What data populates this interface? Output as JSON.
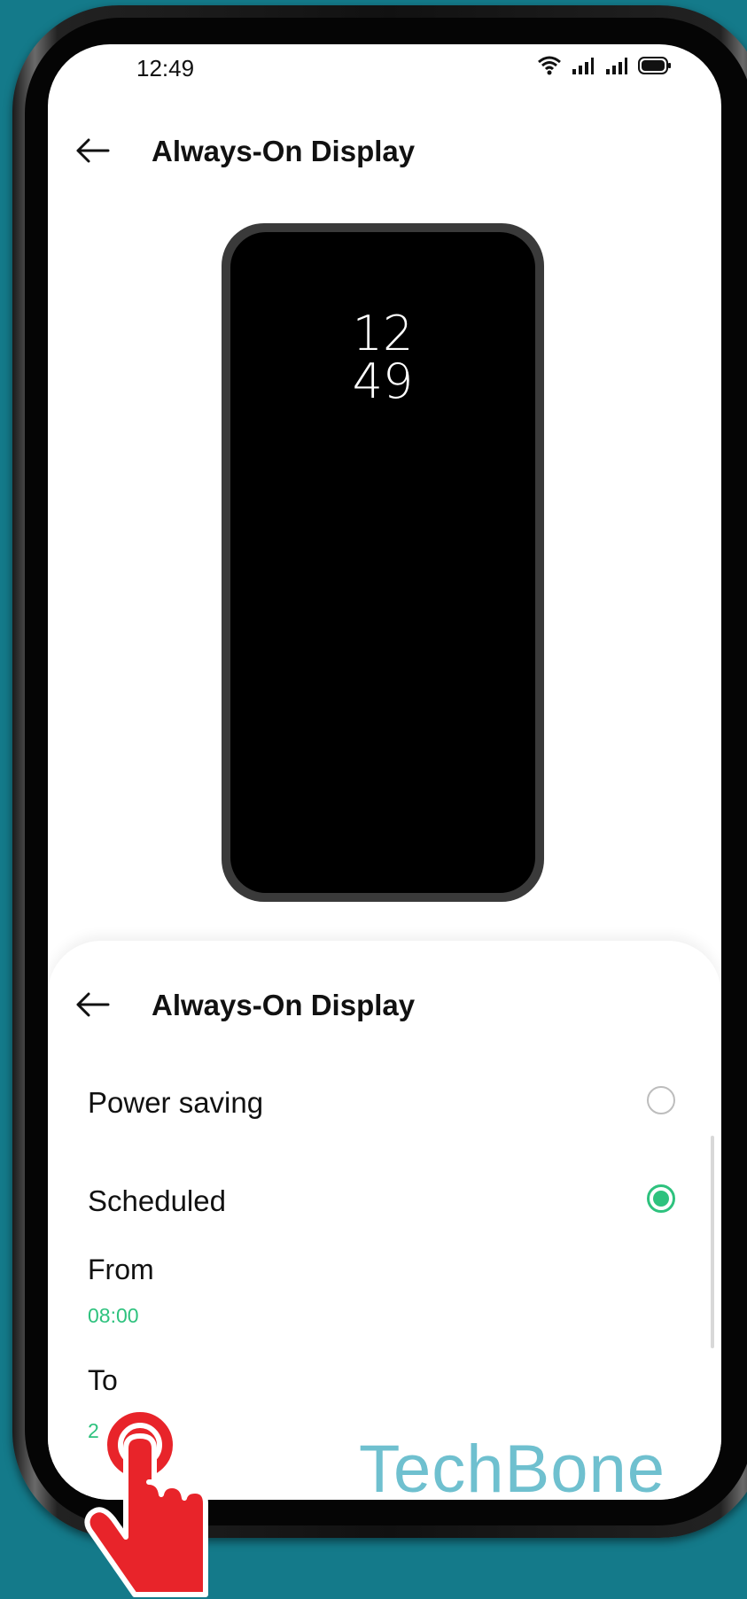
{
  "status_bar": {
    "time": "12:49"
  },
  "header": {
    "title": "Always-On Display"
  },
  "preview": {
    "clock_hours": "12",
    "clock_minutes": "49"
  },
  "sheet": {
    "title": "Always-On Display",
    "options": [
      {
        "label": "Power saving",
        "selected": false
      },
      {
        "label": "Scheduled",
        "selected": true
      }
    ],
    "from_label": "From",
    "from_value": "08:00",
    "to_label": "To",
    "to_value": "2"
  },
  "watermark": "TechBone",
  "colors": {
    "accent": "#2ec27e",
    "background": "#147a8a",
    "watermark": "#6fc0cf",
    "tap_hand": "#e8242a"
  },
  "icons": [
    "wifi-icon",
    "signal-icon",
    "battery-icon",
    "back-arrow-icon",
    "tap-hand-icon"
  ]
}
